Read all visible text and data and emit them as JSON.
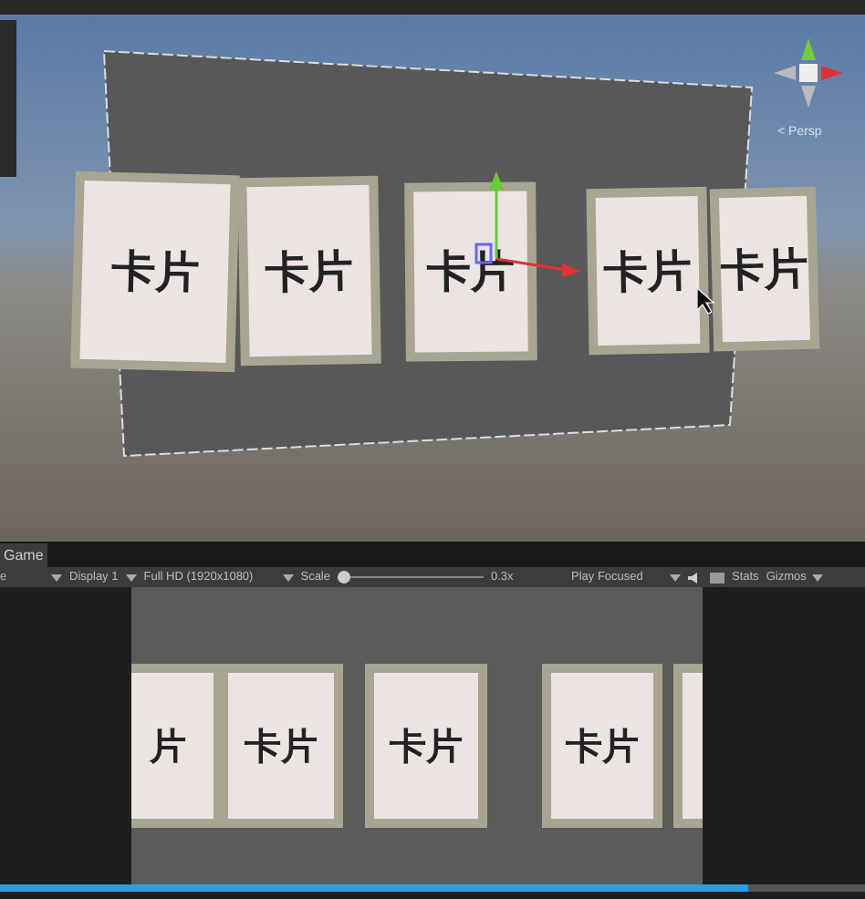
{
  "scene": {
    "view_label": "< Persp",
    "cards": [
      {
        "label": "卡片"
      },
      {
        "label": "卡片"
      },
      {
        "label": "卡片"
      },
      {
        "label": "卡片"
      },
      {
        "label": "卡片"
      }
    ]
  },
  "game": {
    "tab": "Game",
    "aspect": "e",
    "display": "Display 1",
    "resolution": "Full HD (1920x1080)",
    "scale_label": "Scale",
    "scale": {
      "level": 0
    },
    "scale_value": "0.3x",
    "play_mode": "Play Focused",
    "stats": "Stats",
    "gizmos": "Gizmos",
    "cards": [
      {
        "label": "片"
      },
      {
        "label": "卡片"
      },
      {
        "label": "卡片"
      },
      {
        "label": "卡片"
      }
    ],
    "cut_card": true
  }
}
